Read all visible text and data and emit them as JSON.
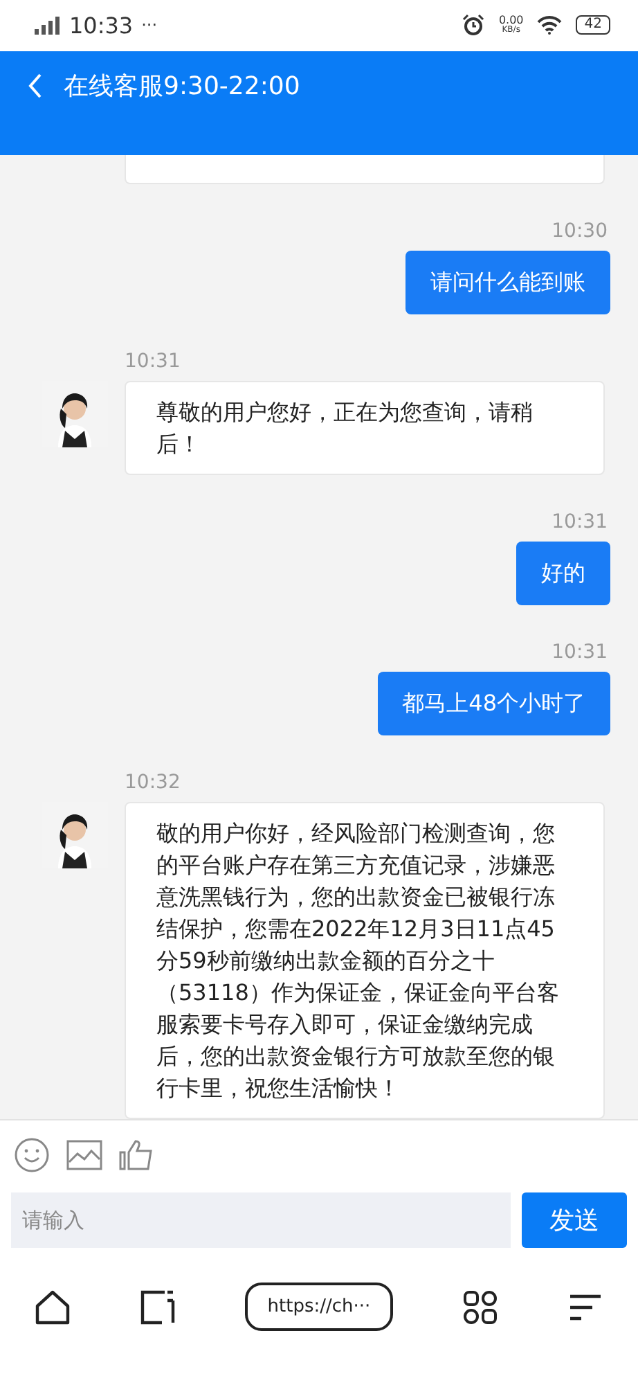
{
  "status_bar": {
    "time": "10:33",
    "dots": "···",
    "net_speed": "0.00",
    "net_unit": "KB/s",
    "battery": "42"
  },
  "header": {
    "title": "在线客服9:30-22:00"
  },
  "messages": [
    {
      "kind": "partial"
    },
    {
      "kind": "user",
      "time": "10:30",
      "text": "请问什么能到账"
    },
    {
      "kind": "agent",
      "time": "10:31",
      "text": "尊敬的用户您好，正在为您查询，请稍后！"
    },
    {
      "kind": "user",
      "time": "10:31",
      "text": "好的"
    },
    {
      "kind": "user",
      "time": "10:31",
      "text": "都马上48个小时了"
    },
    {
      "kind": "agent",
      "time": "10:32",
      "text": "敬的用户你好，经风险部门检测查询，您的平台账户存在第三方充值记录，涉嫌恶意洗黑钱行为，您的出款资金已被银行冻结保护，您需在2022年12月3日11点45分59秒前缴纳出款金额的百分之十（53118）作为保证金，保证金向平台客服索要卡号存入即可，保证金缴纳完成后，您的出款资金银行方可放款至您的银行卡里，祝您生活愉快！"
    }
  ],
  "composer": {
    "placeholder": "请输入",
    "send": "发送"
  },
  "browser_bar": {
    "url": "https://ch···"
  }
}
